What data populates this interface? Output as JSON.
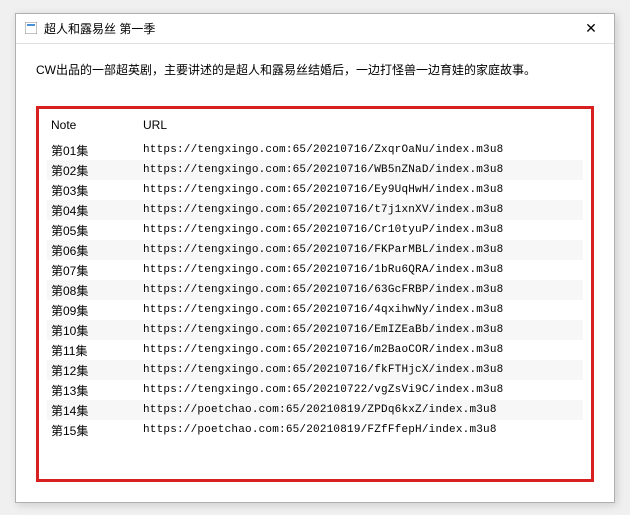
{
  "window": {
    "title": "超人和露易丝 第一季",
    "close_label": "✕"
  },
  "description": "CW出品的一部超英剧，主要讲述的是超人和露易丝结婚后，一边打怪兽一边育娃的家庭故事。",
  "table": {
    "headers": {
      "note": "Note",
      "url": "URL"
    },
    "rows": [
      {
        "note": "第01集",
        "url": "https://tengxingo.com:65/20210716/ZxqrOaNu/index.m3u8"
      },
      {
        "note": "第02集",
        "url": "https://tengxingo.com:65/20210716/WB5nZNaD/index.m3u8"
      },
      {
        "note": "第03集",
        "url": "https://tengxingo.com:65/20210716/Ey9UqHwH/index.m3u8"
      },
      {
        "note": "第04集",
        "url": "https://tengxingo.com:65/20210716/t7j1xnXV/index.m3u8"
      },
      {
        "note": "第05集",
        "url": "https://tengxingo.com:65/20210716/Cr10tyuP/index.m3u8"
      },
      {
        "note": "第06集",
        "url": "https://tengxingo.com:65/20210716/FKParMBL/index.m3u8"
      },
      {
        "note": "第07集",
        "url": "https://tengxingo.com:65/20210716/1bRu6QRA/index.m3u8"
      },
      {
        "note": "第08集",
        "url": "https://tengxingo.com:65/20210716/63GcFRBP/index.m3u8"
      },
      {
        "note": "第09集",
        "url": "https://tengxingo.com:65/20210716/4qxihwNy/index.m3u8"
      },
      {
        "note": "第10集",
        "url": "https://tengxingo.com:65/20210716/EmIZEaBb/index.m3u8"
      },
      {
        "note": "第11集",
        "url": "https://tengxingo.com:65/20210716/m2BaoCOR/index.m3u8"
      },
      {
        "note": "第12集",
        "url": "https://tengxingo.com:65/20210716/fkFTHjcX/index.m3u8"
      },
      {
        "note": "第13集",
        "url": "https://tengxingo.com:65/20210722/vgZsVi9C/index.m3u8"
      },
      {
        "note": "第14集",
        "url": "https://poetchao.com:65/20210819/ZPDq6kxZ/index.m3u8"
      },
      {
        "note": "第15集",
        "url": "https://poetchao.com:65/20210819/FZfFfepH/index.m3u8"
      }
    ]
  }
}
